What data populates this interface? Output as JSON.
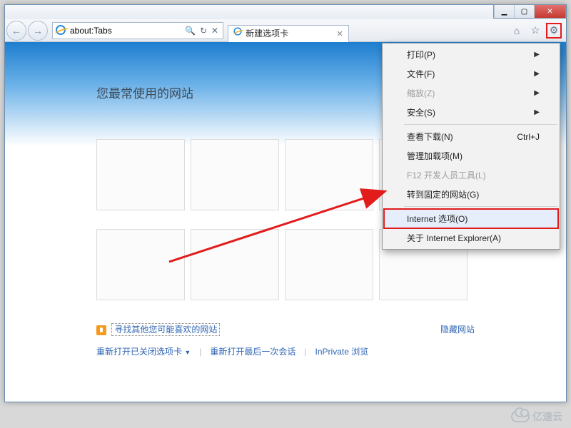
{
  "window": {
    "min": "▁",
    "max": "▢",
    "close": "✕"
  },
  "nav": {
    "back": "←",
    "fwd": "→",
    "address": "about:Tabs",
    "search_icon": "🔍",
    "refresh": "↻",
    "stop": "✕"
  },
  "tab": {
    "title": "新建选项卡",
    "close": "✕"
  },
  "side": {
    "home": "⌂",
    "fav": "☆",
    "gear": "⚙"
  },
  "hero": {
    "title": "您最常使用的网站"
  },
  "links": {
    "discover": "寻找其他您可能喜欢的网站",
    "hide": "隐藏网站",
    "reopen_tabs": "重新打开已关闭选项卡",
    "reopen_last": "重新打开最后一次会话",
    "inprivate": "InPrivate 浏览",
    "caret": "▼",
    "sep": "|"
  },
  "menu": {
    "items": [
      {
        "label": "打印(P)",
        "sub": true
      },
      {
        "label": "文件(F)",
        "sub": true
      },
      {
        "label": "缩放(Z)",
        "sub": true,
        "disabled": true
      },
      {
        "label": "安全(S)",
        "sub": true
      }
    ],
    "items2": [
      {
        "label": "查看下载(N)",
        "accel": "Ctrl+J"
      },
      {
        "label": "管理加载项(M)"
      },
      {
        "label": "F12 开发人员工具(L)",
        "disabled": true
      },
      {
        "label": "转到固定的网站(G)"
      }
    ],
    "items3": [
      {
        "label": "Internet 选项(O)",
        "highlight": true
      },
      {
        "label": "关于 Internet Explorer(A)"
      }
    ],
    "arrow": "▶"
  },
  "watermark": "亿速云"
}
